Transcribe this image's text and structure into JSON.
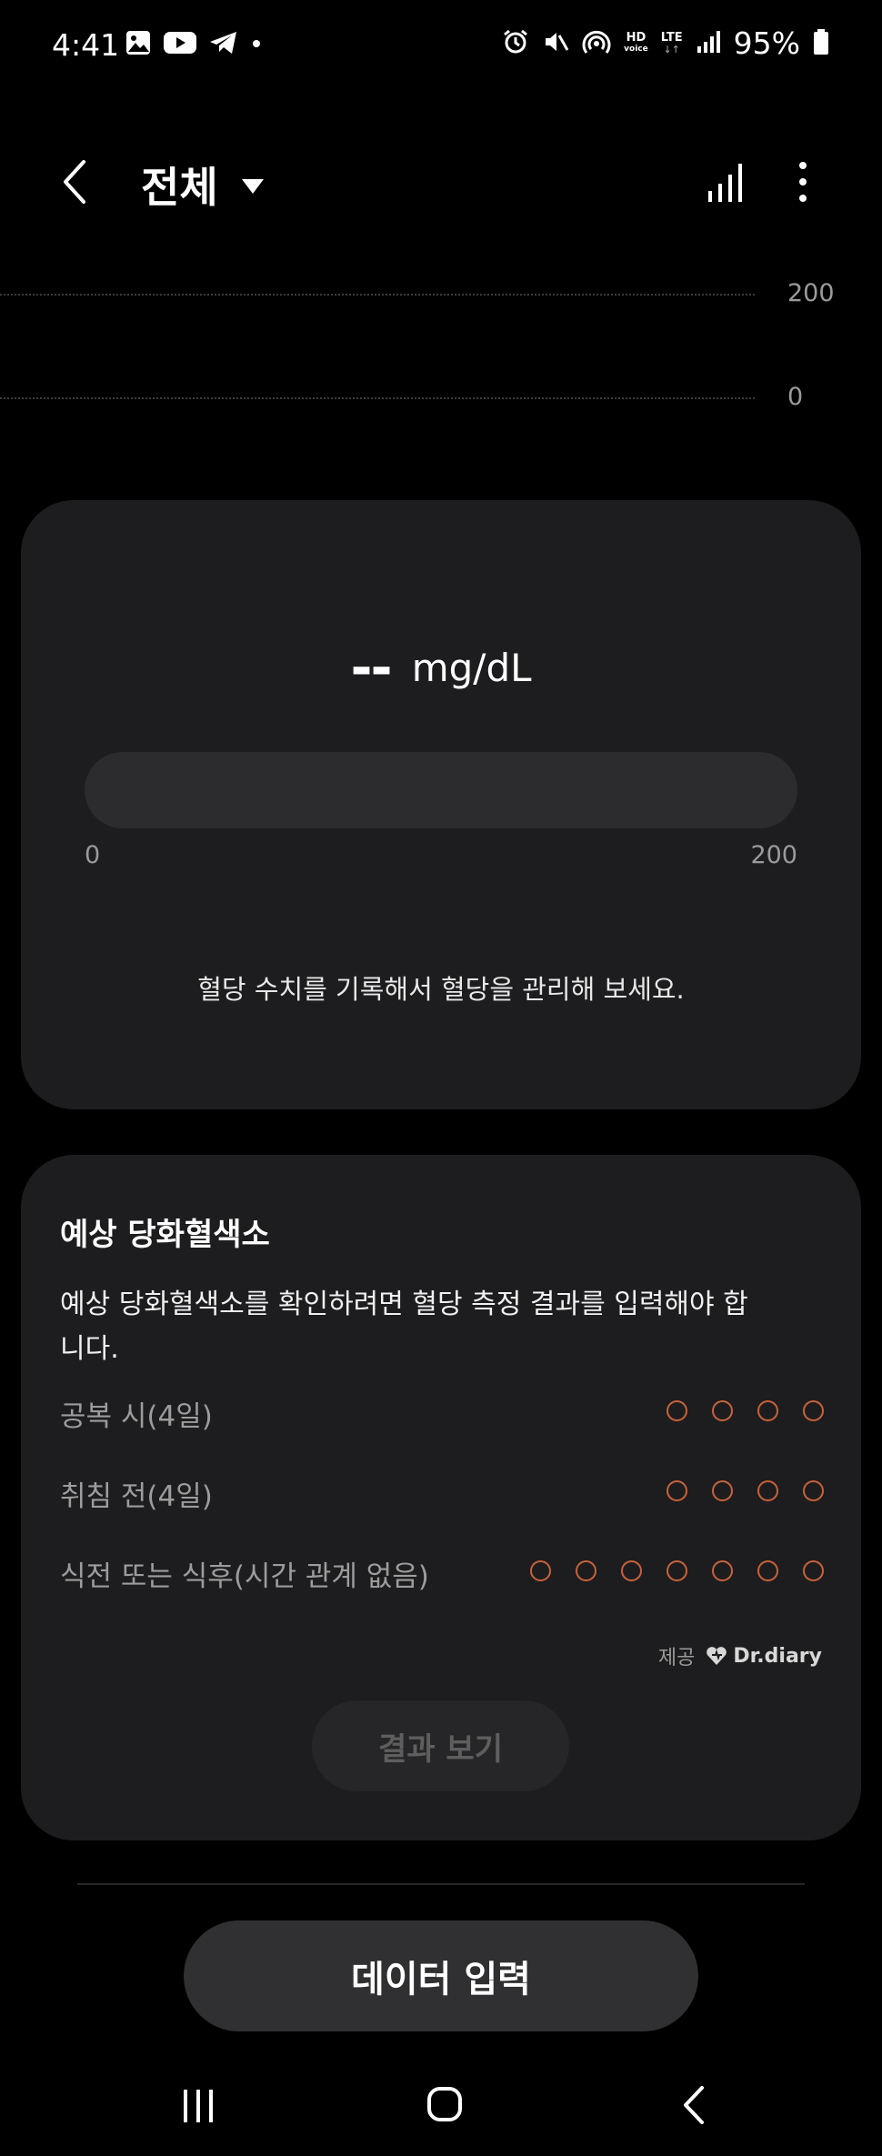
{
  "status_bar": {
    "time": "4:41",
    "battery": "95%",
    "icons": [
      "gallery-icon",
      "youtube-icon",
      "telegram-icon",
      "notification-dot-icon",
      "alarm-icon",
      "mute-icon",
      "hotspot-icon",
      "hd-voice-icon",
      "lte-icon",
      "signal-icon",
      "battery-icon"
    ],
    "hd_label": "HD",
    "voice_label": "voice",
    "lte_label": "LTE"
  },
  "header": {
    "title": "전체",
    "icons": [
      "back-icon",
      "dropdown-caret-icon",
      "chart-icon",
      "more-icon"
    ]
  },
  "mini_chart": {
    "ticks": [
      "200",
      "0"
    ]
  },
  "reading_card": {
    "value": "--",
    "unit": "mg/dL",
    "range_min": "0",
    "range_max": "200",
    "hint": "혈당 수치를 기록해서 혈당을 관리해 보세요."
  },
  "a1c_card": {
    "title": "예상 당화혈색소",
    "description": "예상 당화혈색소를 확인하려면 혈당 측정 결과를 입력해야 합니다.",
    "rows": [
      {
        "label": "공복 시(4일)",
        "dots": 4
      },
      {
        "label": "취침 전(4일)",
        "dots": 4
      },
      {
        "label": "식전 또는 식후(시간 관계 없음)",
        "dots": 7
      }
    ],
    "provider_label": "제공",
    "provider_name": "Dr.diary",
    "result_button": "결과 보기",
    "colors": {
      "dot_outline": "#c8623a"
    }
  },
  "data_input_button": "데이터 입력",
  "nav": {
    "icons": [
      "recent-apps-icon",
      "home-icon",
      "nav-back-icon"
    ]
  }
}
